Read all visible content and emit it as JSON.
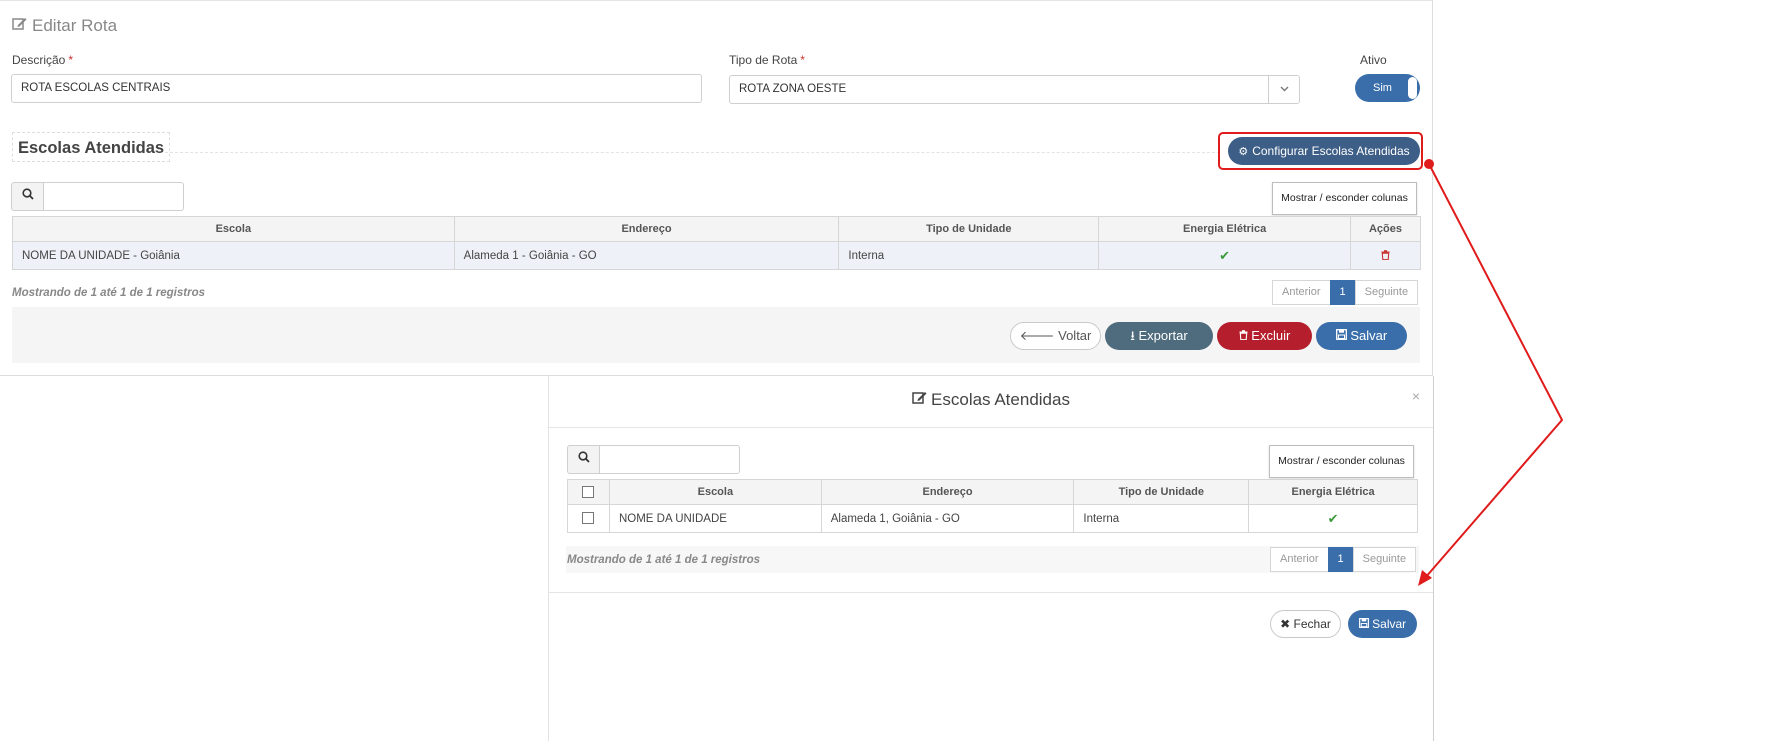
{
  "page": {
    "title": "Editar Rota"
  },
  "form": {
    "descricao_label": "Descrição",
    "descricao_value": "ROTA ESCOLAS CENTRAIS",
    "tipo_label": "Tipo de Rota",
    "tipo_value": "ROTA ZONA OESTE",
    "required_mark": "*",
    "ativo_label": "Ativo",
    "ativo_value": "Sim"
  },
  "section": {
    "title": "Escolas Atendidas",
    "configure_button": "Configurar Escolas Atendidas",
    "toggle_columns": "Mostrar / esconder colunas",
    "headers": [
      "Escola",
      "Endereço",
      "Tipo de Unidade",
      "Energia Elétrica",
      "Ações"
    ],
    "rows": [
      {
        "escola": "NOME DA UNIDADE - Goiânia",
        "endereco": "Alameda 1 - Goiânia - GO",
        "tipo": "Interna",
        "energia": "✔",
        "acoes": "🗑"
      }
    ],
    "info": "Mostrando de 1 até 1 de 1 registros",
    "pager": {
      "prev": "Anterior",
      "current": "1",
      "next": "Seguinte"
    }
  },
  "footer": {
    "voltar": "Voltar",
    "exportar": "Exportar",
    "excluir": "Excluir",
    "salvar": "Salvar"
  },
  "modal": {
    "title": "Escolas Atendidas",
    "close": "×",
    "toggle_columns": "Mostrar / esconder colunas",
    "headers": [
      "Escola",
      "Endereço",
      "Tipo de Unidade",
      "Energia Elétrica"
    ],
    "rows": [
      {
        "escola": "NOME DA UNIDADE",
        "endereco": "Alameda 1, Goiânia - GO",
        "tipo": "Interna",
        "energia": "✔"
      }
    ],
    "info": "Mostrando de 1 até 1 de 1 registros",
    "pager": {
      "prev": "Anterior",
      "current": "1",
      "next": "Seguinte"
    },
    "fechar": "Fechar",
    "salvar": "Salvar"
  },
  "icons": {
    "edit": "edit-icon",
    "search": "search-icon",
    "gear": "gear-icon",
    "check": "check-icon",
    "trash": "trash-icon",
    "arrow_left": "arrow-left-icon",
    "download": "download-icon",
    "save": "save-icon",
    "close": "close-icon",
    "chevron_down": "chevron-down-icon"
  },
  "colors": {
    "primary": "#3a6eaa",
    "config_button": "#3d5e86",
    "export": "#4f6b7e",
    "danger": "#b51e2c",
    "annotation": "#e01b1b",
    "success": "#3a9a3a"
  }
}
